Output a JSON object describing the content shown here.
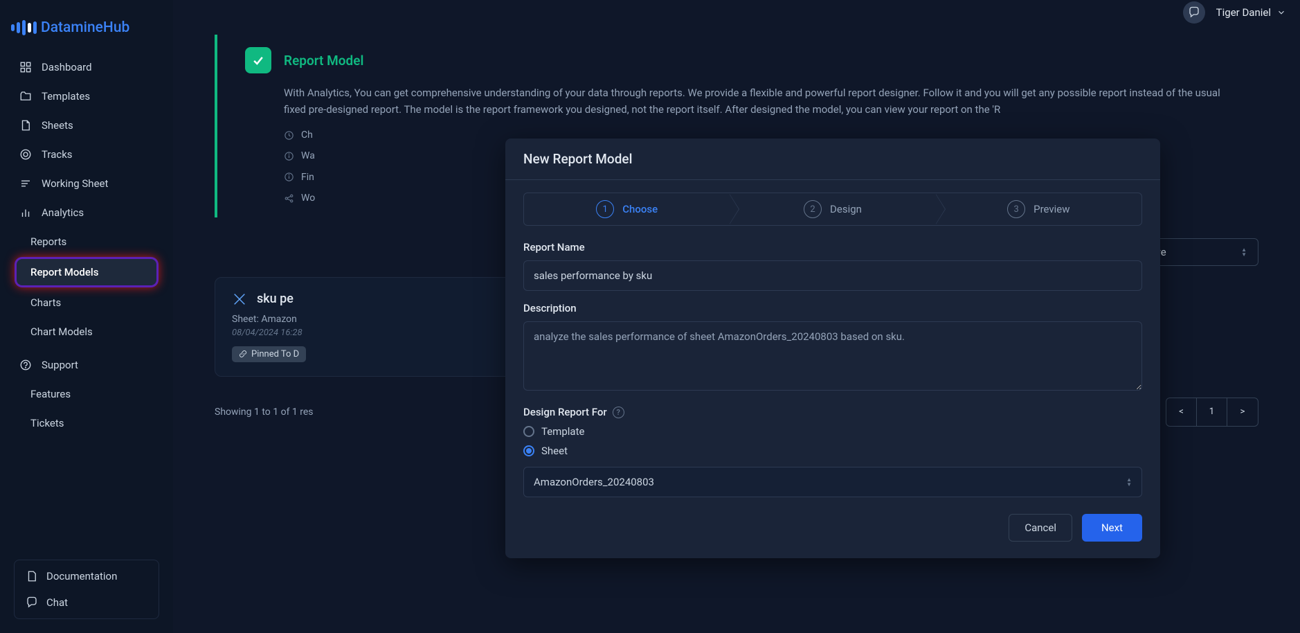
{
  "brand": "DatamineHub",
  "header": {
    "user_name": "Tiger Daniel"
  },
  "sidebar": {
    "items": [
      {
        "label": "Dashboard"
      },
      {
        "label": "Templates"
      },
      {
        "label": "Sheets"
      },
      {
        "label": "Tracks"
      },
      {
        "label": "Working Sheet"
      },
      {
        "label": "Analytics"
      }
    ],
    "sub_items": [
      {
        "label": "Reports"
      },
      {
        "label": "Report Models"
      },
      {
        "label": "Charts"
      },
      {
        "label": "Chart Models"
      }
    ],
    "support_label": "Support",
    "support_items": [
      {
        "label": "Features"
      },
      {
        "label": "Tickets"
      }
    ],
    "bottom": {
      "documentation": "Documentation",
      "chat": "Chat"
    }
  },
  "info_panel": {
    "title": "Report Model",
    "body": "With Analytics, You can get comprehensive understanding of your data through reports. We provide a flexible and powerful report designer. Follow it and you will get any possible report instead of the usual fixed pre-designed report. The model is the report framework you designed, not the report itself. After designed the model, you can view your report on the 'R",
    "links": [
      "Ch",
      "Wa",
      "Fin",
      "Wo"
    ]
  },
  "toolbar": {
    "new_model_label": "New Report Model",
    "status_value": "active"
  },
  "card": {
    "title": "sku pe",
    "sheet_line": "Sheet: Amazon",
    "timestamp": "08/04/2024 16:28",
    "pinned_label": "Pinned To D"
  },
  "footer": {
    "results_text": "Showing 1 to 1 of 1 res",
    "prev": "<",
    "page": "1",
    "next": ">"
  },
  "modal": {
    "title": "New Report Model",
    "steps": [
      {
        "num": "1",
        "label": "Choose"
      },
      {
        "num": "2",
        "label": "Design"
      },
      {
        "num": "3",
        "label": "Preview"
      }
    ],
    "report_name_label": "Report Name",
    "report_name_value": "sales performance by sku",
    "description_label": "Description",
    "description_value": "analyze the sales performance of sheet AmazonOrders_20240803 based on sku.",
    "design_for_label": "Design Report For",
    "radio_template": "Template",
    "radio_sheet": "Sheet",
    "dropdown_value": "AmazonOrders_20240803",
    "cancel": "Cancel",
    "next": "Next"
  }
}
